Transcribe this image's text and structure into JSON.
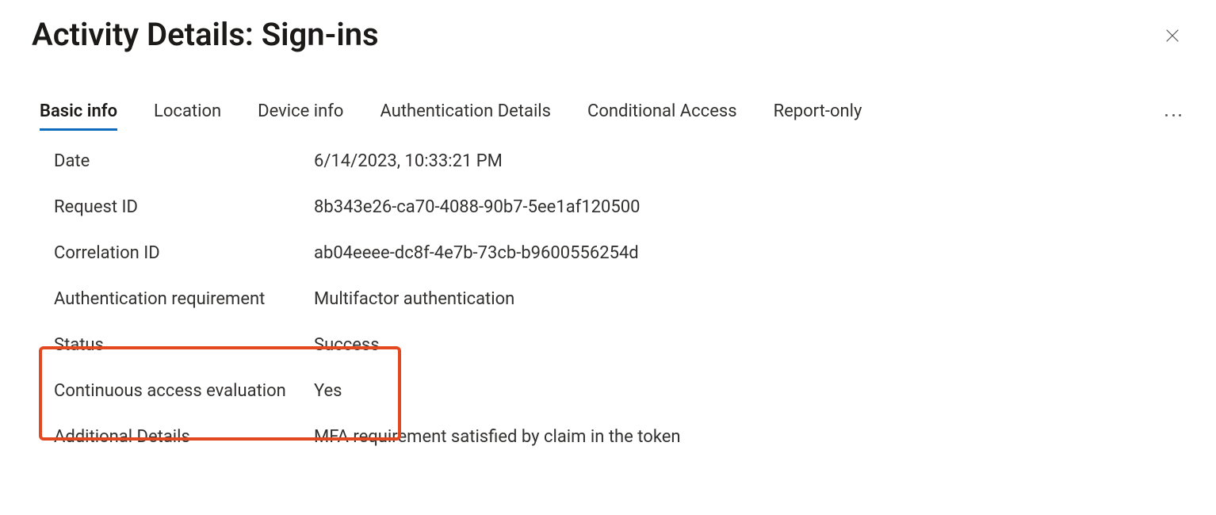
{
  "header": {
    "title": "Activity Details: Sign-ins"
  },
  "tabs": {
    "basic_info": "Basic info",
    "location": "Location",
    "device_info": "Device info",
    "auth_details": "Authentication Details",
    "conditional_access": "Conditional Access",
    "report_only": "Report-only"
  },
  "details": {
    "date_label": "Date",
    "date_value": "6/14/2023, 10:33:21 PM",
    "request_id_label": "Request ID",
    "request_id_value": "8b343e26-ca70-4088-90b7-5ee1af120500",
    "correlation_id_label": "Correlation ID",
    "correlation_id_value": "ab04eeee-dc8f-4e7b-73cb-b9600556254d",
    "auth_req_label": "Authentication requirement",
    "auth_req_value": "Multifactor authentication",
    "status_label": "Status",
    "status_value": "Success",
    "cae_label": "Continuous access evaluation",
    "cae_value": "Yes",
    "additional_label": "Additional Details",
    "additional_value": "MFA requirement satisfied by claim in the token"
  }
}
